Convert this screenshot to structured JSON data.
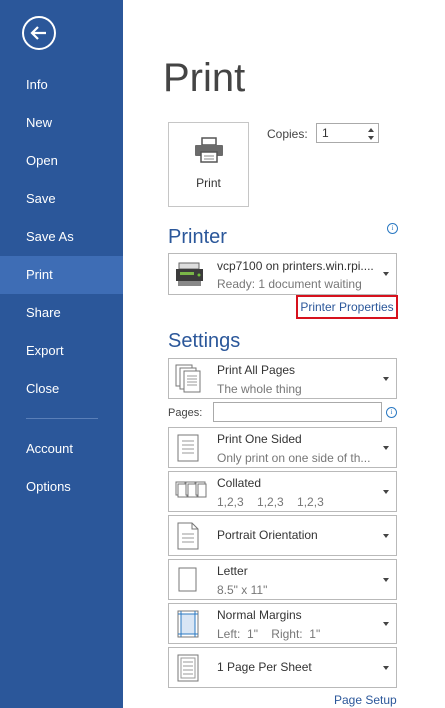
{
  "sidebar": {
    "back_icon": "back-arrow-icon",
    "items": [
      {
        "label": "Info"
      },
      {
        "label": "New"
      },
      {
        "label": "Open"
      },
      {
        "label": "Save"
      },
      {
        "label": "Save As"
      },
      {
        "label": "Print"
      },
      {
        "label": "Share"
      },
      {
        "label": "Export"
      },
      {
        "label": "Close"
      },
      {
        "label": "Account"
      },
      {
        "label": "Options"
      }
    ],
    "active": "Print"
  },
  "main": {
    "title": "Print",
    "print_button_label": "Print",
    "copies_label": "Copies:",
    "copies_value": "1"
  },
  "printer": {
    "section_title": "Printer",
    "name": "vcp7100 on printers.win.rpi....",
    "status": "Ready: 1 document waiting",
    "properties_link": "Printer Properties"
  },
  "settings": {
    "section_title": "Settings",
    "pages_label": "Pages:",
    "pages_value": "",
    "options": [
      {
        "line1": "Print All Pages",
        "line2": "The whole thing"
      },
      {
        "line1": "Print One Sided",
        "line2": "Only print on one side of th..."
      },
      {
        "line1": "Collated",
        "line2": "1,2,3    1,2,3    1,2,3"
      },
      {
        "line1": "Portrait Orientation",
        "line2": ""
      },
      {
        "line1": "Letter",
        "line2": "8.5\" x 11\""
      },
      {
        "line1": "Normal Margins",
        "line2": "Left:  1\"    Right:  1\""
      },
      {
        "line1": "1 Page Per Sheet",
        "line2": ""
      }
    ],
    "page_setup_link": "Page Setup"
  },
  "colors": {
    "sidebar": "#2b579a",
    "sidebar_active": "#3e6db5",
    "accent": "#2b579a",
    "highlight_box": "#d6111d"
  }
}
